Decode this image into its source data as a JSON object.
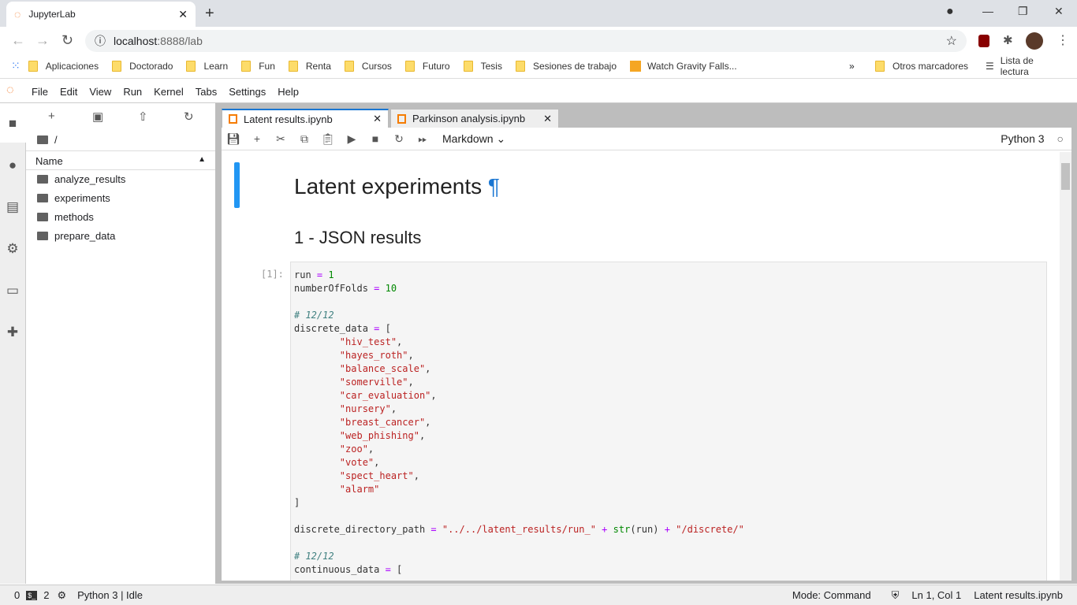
{
  "browser": {
    "tab_title": "JupyterLab",
    "url_host": "localhost",
    "url_rest": ":8888/lab",
    "bookmarks": [
      "Aplicaciones",
      "Doctorado",
      "Learn",
      "Fun",
      "Renta",
      "Cursos",
      "Futuro",
      "Tesis",
      "Sesiones de trabajo",
      "Watch Gravity Falls..."
    ],
    "more": "»",
    "other_bookmarks": "Otros marcadores",
    "reading_list": "Lista de lectura"
  },
  "menu": [
    "File",
    "Edit",
    "View",
    "Run",
    "Kernel",
    "Tabs",
    "Settings",
    "Help"
  ],
  "filebrowser": {
    "path": "/",
    "column": "Name",
    "items": [
      "analyze_results",
      "experiments",
      "methods",
      "prepare_data"
    ]
  },
  "notebook_tabs": [
    {
      "label": "Latent results.ipynb",
      "active": true
    },
    {
      "label": "Parkinson analysis.ipynb",
      "active": false
    }
  ],
  "toolbar": {
    "cell_type": "Markdown",
    "kernel": "Python 3"
  },
  "notebook": {
    "h1": "Latent experiments",
    "pilcrow": "¶",
    "h2": "1 - JSON results",
    "prompt": "[1]:",
    "code": [
      [
        [
          "run ",
          ""
        ],
        [
          "=",
          "op"
        ],
        [
          " ",
          ""
        ],
        [
          "1",
          "num"
        ]
      ],
      [
        [
          "numberOfFolds ",
          ""
        ],
        [
          "=",
          "op"
        ],
        [
          " ",
          ""
        ],
        [
          "10",
          "num"
        ]
      ],
      [],
      [
        [
          "# 12/12",
          "cm"
        ]
      ],
      [
        [
          "discrete_data ",
          ""
        ],
        [
          "=",
          "op"
        ],
        [
          " [",
          ""
        ]
      ],
      [
        [
          "        ",
          ""
        ],
        [
          "\"hiv_test\"",
          "str"
        ],
        [
          ",",
          ""
        ]
      ],
      [
        [
          "        ",
          ""
        ],
        [
          "\"hayes_roth\"",
          "str"
        ],
        [
          ",",
          ""
        ]
      ],
      [
        [
          "        ",
          ""
        ],
        [
          "\"balance_scale\"",
          "str"
        ],
        [
          ",",
          ""
        ]
      ],
      [
        [
          "        ",
          ""
        ],
        [
          "\"somerville\"",
          "str"
        ],
        [
          ",",
          ""
        ]
      ],
      [
        [
          "        ",
          ""
        ],
        [
          "\"car_evaluation\"",
          "str"
        ],
        [
          ",",
          ""
        ]
      ],
      [
        [
          "        ",
          ""
        ],
        [
          "\"nursery\"",
          "str"
        ],
        [
          ",",
          ""
        ]
      ],
      [
        [
          "        ",
          ""
        ],
        [
          "\"breast_cancer\"",
          "str"
        ],
        [
          ",",
          ""
        ]
      ],
      [
        [
          "        ",
          ""
        ],
        [
          "\"web_phishing\"",
          "str"
        ],
        [
          ",",
          ""
        ]
      ],
      [
        [
          "        ",
          ""
        ],
        [
          "\"zoo\"",
          "str"
        ],
        [
          ",",
          ""
        ]
      ],
      [
        [
          "        ",
          ""
        ],
        [
          "\"vote\"",
          "str"
        ],
        [
          ",",
          ""
        ]
      ],
      [
        [
          "        ",
          ""
        ],
        [
          "\"spect_heart\"",
          "str"
        ],
        [
          ",",
          ""
        ]
      ],
      [
        [
          "        ",
          ""
        ],
        [
          "\"alarm\"",
          "str"
        ]
      ],
      [
        [
          "]",
          ""
        ]
      ],
      [],
      [
        [
          "discrete_directory_path ",
          ""
        ],
        [
          "=",
          "op"
        ],
        [
          " ",
          ""
        ],
        [
          "\"../../latent_results/run_\"",
          "str"
        ],
        [
          " ",
          ""
        ],
        [
          "+",
          "op"
        ],
        [
          " ",
          ""
        ],
        [
          "str",
          "bi"
        ],
        [
          "(run) ",
          ""
        ],
        [
          "+",
          "op"
        ],
        [
          " ",
          ""
        ],
        [
          "\"/discrete/\"",
          "str"
        ]
      ],
      [],
      [
        [
          "# 12/12",
          "cm"
        ]
      ],
      [
        [
          "continuous_data ",
          ""
        ],
        [
          "=",
          "op"
        ],
        [
          " [",
          ""
        ]
      ]
    ]
  },
  "status": {
    "left_a": "0",
    "left_b": "2",
    "kernel": "Python 3 | Idle",
    "mode": "Mode: Command",
    "position": "Ln 1, Col 1",
    "file": "Latent results.ipynb"
  }
}
